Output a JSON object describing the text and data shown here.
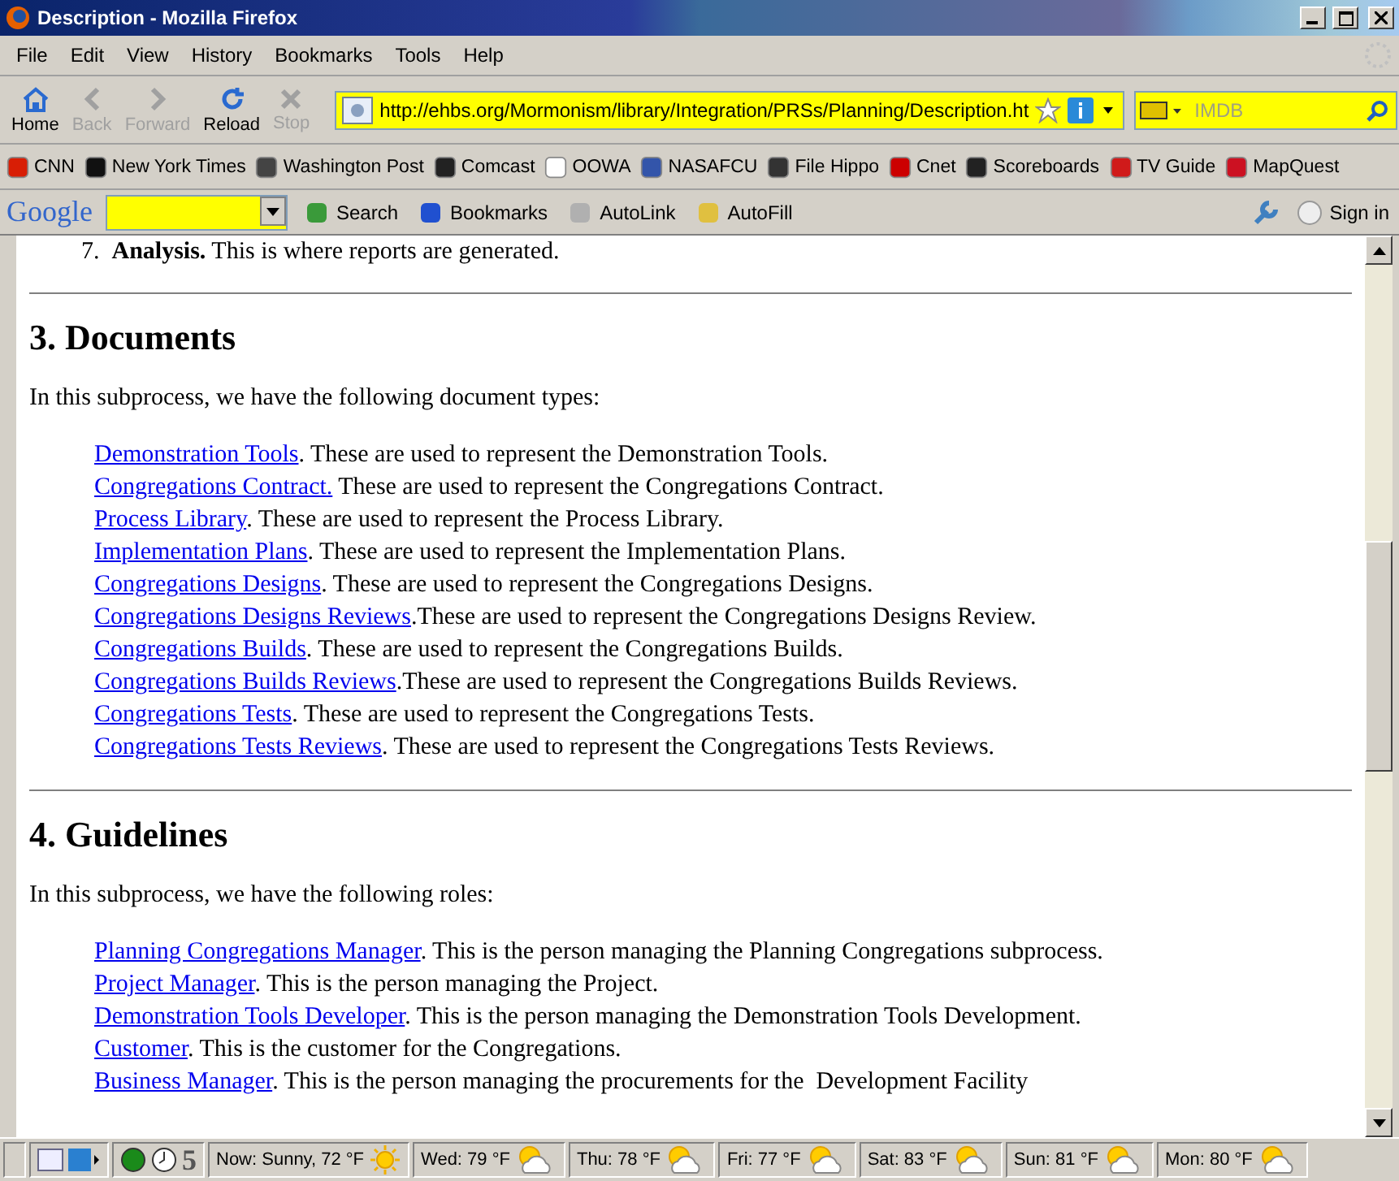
{
  "window": {
    "title": "Description - Mozilla Firefox"
  },
  "menu": [
    "File",
    "Edit",
    "View",
    "History",
    "Bookmarks",
    "Tools",
    "Help"
  ],
  "nav_buttons": [
    {
      "kind": "home",
      "label": "Home",
      "disabled": false
    },
    {
      "kind": "back",
      "label": "Back",
      "disabled": true
    },
    {
      "kind": "forward",
      "label": "Forward",
      "disabled": true
    },
    {
      "kind": "reload",
      "label": "Reload",
      "disabled": false
    },
    {
      "kind": "stop",
      "label": "Stop",
      "disabled": true
    }
  ],
  "address": {
    "value": "http://ehbs.org/Mormonism/library/Integration/PRSs/Planning/Description.ht"
  },
  "search": {
    "placeholder": "IMDB"
  },
  "bookmarks": [
    {
      "label": "CNN",
      "color": "#d81e05"
    },
    {
      "label": "New York Times",
      "color": "#111111"
    },
    {
      "label": "Washington Post",
      "color": "#444444"
    },
    {
      "label": "Comcast",
      "color": "#222222"
    },
    {
      "label": "OOWA",
      "color": "#ffffff"
    },
    {
      "label": "NASAFCU",
      "color": "#3355aa"
    },
    {
      "label": "File Hippo",
      "color": "#333333"
    },
    {
      "label": "Cnet",
      "color": "#cc0000"
    },
    {
      "label": "Scoreboards",
      "color": "#222222"
    },
    {
      "label": "TV Guide",
      "color": "#d01a1a"
    },
    {
      "label": "MapQuest",
      "color": "#cc1122"
    }
  ],
  "google_toolbar": {
    "logo": "Google",
    "items": [
      "Search",
      "Bookmarks",
      "AutoLink",
      "AutoFill"
    ],
    "sign_in": "Sign in"
  },
  "content": {
    "list_item": {
      "number": "7.",
      "title": "Analysis.",
      "text": " This is where reports are generated."
    },
    "sections": [
      {
        "heading": "3. Documents",
        "intro": "In this subprocess, we have the following document types:",
        "entries": [
          {
            "link": "Demonstration Tools",
            "text": ". These are used to represent the Demonstration Tools."
          },
          {
            "link": "Congregations Contract.",
            "text": " These are used to represent the Congregations Contract."
          },
          {
            "link": "Process Library",
            "text": ". These are used to represent the Process Library."
          },
          {
            "link": "Implementation Plans",
            "text": ". These are used to represent the Implementation Plans."
          },
          {
            "link": "Congregations Designs",
            "text": ". These are used to represent the Congregations Designs."
          },
          {
            "link": "Congregations Designs Reviews",
            "text": ".These are used to represent the Congregations Designs Review."
          },
          {
            "link": "Congregations Builds",
            "text": ". These are used to represent the Congregations Builds."
          },
          {
            "link": "Congregations Builds Reviews",
            "text": ".These are used to represent the Congregations Builds Reviews."
          },
          {
            "link": "Congregations Tests",
            "text": ". These are used to represent the Congregations Tests."
          },
          {
            "link": "Congregations Tests Reviews",
            "text": ". These are used to represent the Congregations Tests Reviews."
          }
        ]
      },
      {
        "heading": "4. Guidelines",
        "intro": "In this subprocess, we have the following roles:",
        "entries": [
          {
            "link": "Planning Congregations Manager",
            "text": ". This is the person managing the Planning Congregations subprocess."
          },
          {
            "link": "Project Manager",
            "text": ". This is the person managing the Project."
          },
          {
            "link": "Demonstration Tools Developer",
            "text": ". This is the person managing the Demonstration Tools Development."
          },
          {
            "link": "Customer",
            "text": ". This is the customer for the Congregations."
          },
          {
            "link": "Business Manager",
            "text": ". This is the person managing the procurements for the  Development Facility"
          }
        ]
      }
    ]
  },
  "status_bar": {
    "counter": "5",
    "now": "Now: Sunny, 72 °F",
    "forecast": [
      "Wed: 79 °F",
      "Thu: 78 °F",
      "Fri: 77 °F",
      "Sat: 83 °F",
      "Sun: 81 °F",
      "Mon: 80 °F"
    ]
  }
}
